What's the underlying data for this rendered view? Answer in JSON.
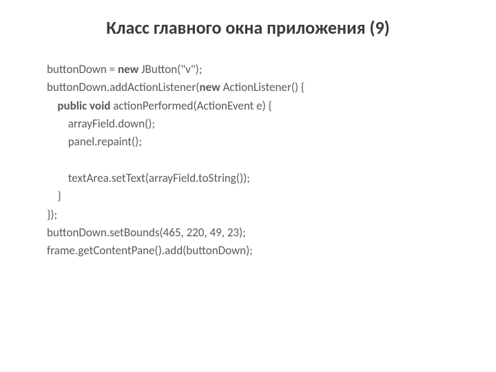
{
  "title": "Класс главного окна приложения (9)",
  "code": {
    "l1a": "buttonDown = ",
    "l1b": "new",
    "l1c": " JButton(\"v\");",
    "l2a": "buttonDown.addActionListener(",
    "l2b": "new",
    "l2c": " ActionListener() {",
    "l3a": "public void",
    "l3b": " actionPerformed(ActionEvent e) {",
    "l4": "arrayField.down();",
    "l5": "panel.repaint();",
    "l6": "",
    "l7": "textArea.setText(arrayField.toString());",
    "l8": "}",
    "l9": "});",
    "l10": "buttonDown.setBounds(465, 220, 49, 23);",
    "l11": "frame.getContentPane().add(buttonDown);"
  }
}
